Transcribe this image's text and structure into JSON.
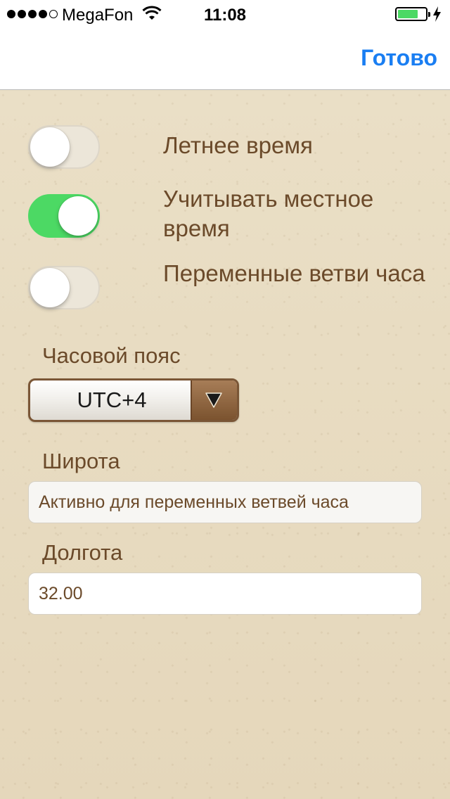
{
  "status_bar": {
    "carrier": "MegaFon",
    "time": "11:08",
    "signal_dots_filled": 4,
    "signal_dots_total": 5,
    "battery_color": "#4cd964"
  },
  "nav_bar": {
    "done_label": "Готово",
    "accent_color": "#1a7ef2"
  },
  "settings": {
    "daylight_saving": {
      "label": "Летнее время",
      "on": false
    },
    "local_time": {
      "label": "Учитывать местное время",
      "on": true
    },
    "variable_hours": {
      "label": "Переменные ветви часа",
      "on": false
    }
  },
  "timezone": {
    "label": "Часовой пояс",
    "value": "UTC+4"
  },
  "latitude": {
    "label": "Широта",
    "placeholder": "Активно для переменных ветвей часа",
    "value": ""
  },
  "longitude": {
    "label": "Долгота",
    "value": "32.00"
  },
  "colors": {
    "text_brown": "#6b4a2a",
    "toggle_on": "#4cd964"
  }
}
